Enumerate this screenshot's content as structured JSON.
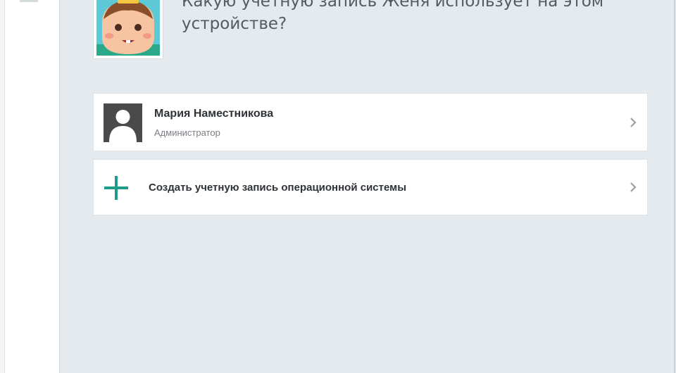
{
  "question": "Какую учетную запись Женя использует на этом устройстве?",
  "accounts": [
    {
      "name": "Мария Наместникова",
      "role": "Администратор",
      "icon": "user-silhouette-icon"
    }
  ],
  "create_account": {
    "label": "Создать учетную запись операционной системы",
    "icon": "plus-icon"
  },
  "child_avatar": {
    "icon": "cartoon-child-avatar"
  },
  "colors": {
    "background": "#e4eaee",
    "card": "#ffffff",
    "accent": "#1e9a8a",
    "text": "#2e3236",
    "muted_text": "#7a7f84"
  }
}
